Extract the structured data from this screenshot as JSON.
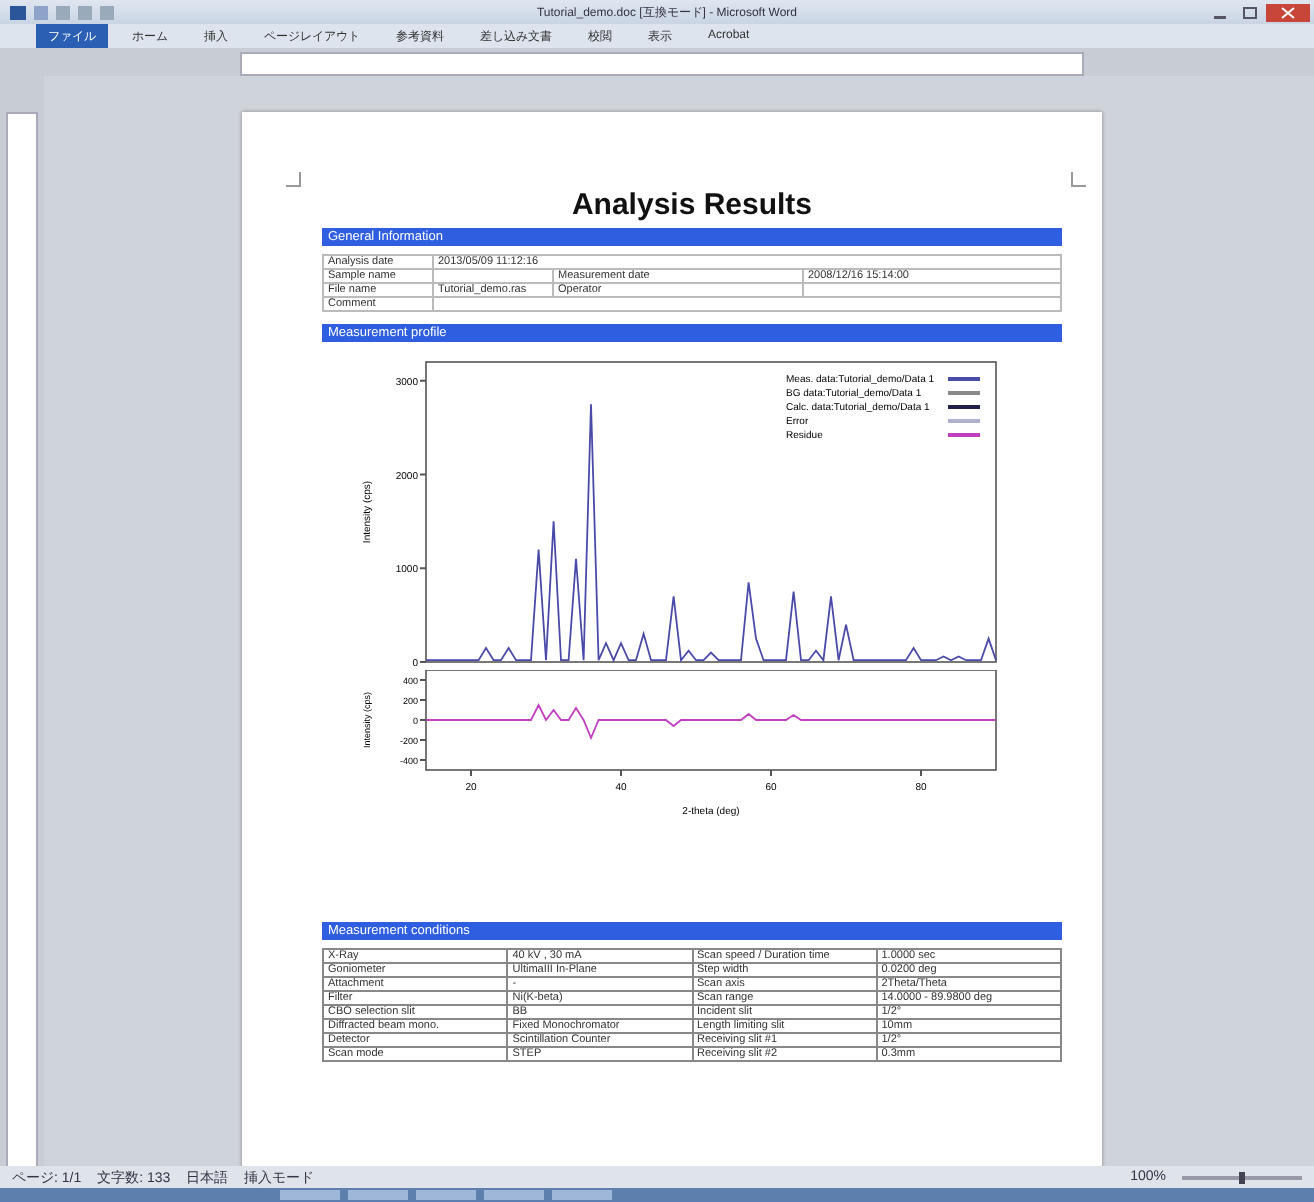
{
  "window": {
    "title": "Tutorial_demo.doc [互換モード] - Microsoft Word"
  },
  "tabs": [
    {
      "label": "ファイル",
      "selected": true
    },
    {
      "label": "ホーム",
      "selected": false
    },
    {
      "label": "挿入",
      "selected": false
    },
    {
      "label": "ページレイアウト",
      "selected": false
    },
    {
      "label": "参考資料",
      "selected": false
    },
    {
      "label": "差し込み文書",
      "selected": false
    },
    {
      "label": "校閲",
      "selected": false
    },
    {
      "label": "表示",
      "selected": false
    },
    {
      "label": "Acrobat",
      "selected": false
    }
  ],
  "document": {
    "title": "Analysis Results",
    "general": {
      "heading": "General Information",
      "rows": [
        {
          "label": "Analysis date",
          "value": "2013/05/09 11:12:16"
        },
        {
          "label": "Sample name",
          "label_2": "Measurement date",
          "value_2": "2008/12/16 15:14:00"
        },
        {
          "label": "File name",
          "value": "Tutorial_demo.ras",
          "label_2": "Operator"
        },
        {
          "label": "Comment"
        }
      ]
    },
    "profile": {
      "heading": "Measurement profile",
      "legend": [
        {
          "label": "BG data:Tutorial_demo/Data 1",
          "color": "#8a8a8a"
        },
        {
          "label": "Calc. data:Tutorial_demo/Data 1",
          "color": "#20204a"
        },
        {
          "label": "Error",
          "color": "#b0b0d0"
        }
      ],
      "chart_data": {
        "type": "line",
        "ylabel": "Intensity (cps)",
        "ylim": [
          0,
          3200
        ],
        "yticks": [
          0,
          1000,
          2000,
          3000
        ],
        "categories": [
          null,
          null,
          null,
          null,
          null,
          null,
          null,
          null,
          null,
          null,
          null,
          null,
          null,
          null,
          null,
          null,
          null,
          null,
          null,
          null,
          null,
          null,
          null,
          null,
          null,
          null,
          null,
          null,
          null,
          null,
          null,
          null,
          null,
          null,
          null,
          null,
          null,
          null,
          null,
          null,
          null,
          null,
          null,
          null,
          null,
          null,
          null,
          null,
          null,
          null,
          null,
          null,
          null,
          null,
          null,
          null,
          null,
          null,
          null,
          null,
          null,
          null,
          null,
          null,
          null,
          null,
          null,
          null,
          null,
          null,
          null,
          null,
          null,
          null,
          null,
          null,
          null
        ],
        "series": [
          {
            "name": "Meas. data:Tutorial_demo/Data 1",
            "color": "#4a4aa8",
            "values": [
              20,
              20,
              20,
              20,
              20,
              20,
              20,
              20,
              150,
              20,
              20,
              150,
              20,
              20,
              20,
              1200,
              20,
              1500,
              20,
              20,
              1100,
              20,
              2750,
              20,
              200,
              20,
              200,
              20,
              20,
              300,
              20,
              20,
              20,
              700,
              20,
              120,
              20,
              20,
              100,
              20,
              20,
              20,
              20,
              850,
              250,
              20,
              20,
              20,
              20,
              750,
              20,
              20,
              120,
              20,
              700,
              20,
              400,
              20,
              20,
              20,
              20,
              20,
              20,
              20,
              20,
              150,
              20,
              20,
              20,
              60,
              20,
              60,
              20,
              20,
              20,
              250,
              20
            ]
          }
        ]
      },
      "residue": {
        "chart_data": {
          "type": "line",
          "xlabel": "2-theta (deg)",
          "ylabel": "Intensity (cps)",
          "xlim": [
            14,
            90
          ],
          "ylim": [
            -500,
            500
          ],
          "xticks": [
            20,
            40,
            60,
            80
          ],
          "yticks": [
            -400,
            -200,
            0,
            200,
            400
          ],
          "x": [
            14,
            28,
            29,
            30,
            31,
            32,
            33,
            34,
            35,
            36,
            37,
            46,
            47,
            48,
            56,
            57,
            58,
            62,
            63,
            64,
            90
          ],
          "series": [
            {
              "name": "Residue",
              "color": "#c040c0",
              "values": [
                0,
                0,
                150,
                0,
                100,
                0,
                0,
                120,
                0,
                -180,
                0,
                0,
                -60,
                0,
                0,
                60,
                0,
                0,
                50,
                0,
                0
              ]
            }
          ]
        }
      }
    },
    "conditions": {
      "heading": "Measurement conditions",
      "rows": [
        [
          "X-Ray",
          "40 kV , 30 mA",
          "Scan speed / Duration time",
          "1.0000 sec"
        ],
        [
          "Goniometer",
          "UltimaIII In-Plane",
          "Step width",
          "0.0200 deg"
        ],
        [
          "Attachment",
          "-",
          "Scan axis",
          "2Theta/Theta"
        ],
        [
          "Filter",
          "Ni(K-beta)",
          "Scan range",
          "14.0000 - 89.9800 deg"
        ],
        [
          "CBO selection slit",
          "BB",
          "Incident slit",
          "1/2°"
        ],
        [
          "Diffracted beam mono.",
          "Fixed Monochromator",
          "Length limiting slit",
          "10mm"
        ],
        [
          "Detector",
          "Scintillation Counter",
          "Receiving slit #1",
          "1/2°"
        ],
        [
          "Scan mode",
          "STEP",
          "Receiving slit #2",
          "0.3mm"
        ]
      ]
    }
  },
  "status_bar": {
    "items": [
      "ページ: 1/1",
      "文字数: 133",
      "日本語",
      "挿入モード"
    ],
    "zoom": {
      "label": "100%",
      "level": 0.5
    }
  }
}
